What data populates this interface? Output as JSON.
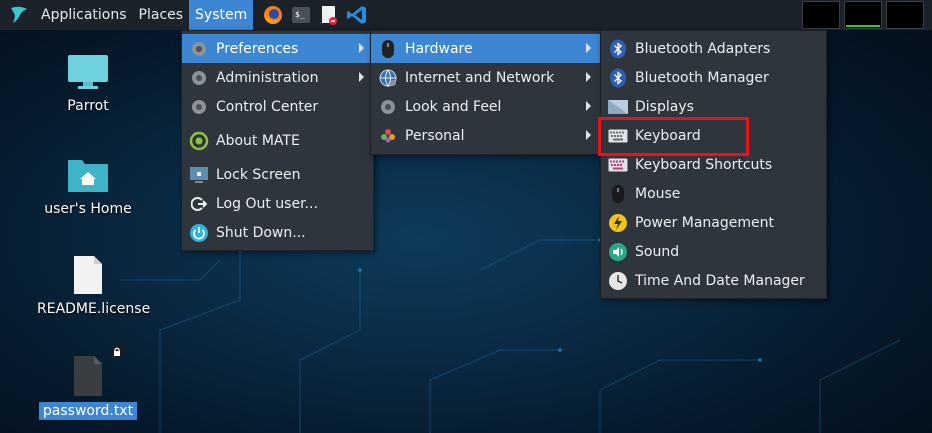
{
  "panel": {
    "menus": [
      "Applications",
      "Places",
      "System"
    ],
    "active_menu": "System",
    "launchers": [
      "firefox-icon",
      "terminal-icon",
      "text-editor-icon",
      "vscode-icon"
    ]
  },
  "desktop": {
    "icons": [
      {
        "label": "Parrot",
        "icon": "computer-icon"
      },
      {
        "label": "user's Home",
        "icon": "home-folder-icon"
      },
      {
        "label": "README.license",
        "icon": "document-icon"
      },
      {
        "label": "password.txt",
        "icon": "locked-file-icon",
        "selected": true
      }
    ]
  },
  "system_menu": {
    "items": [
      {
        "label": "Preferences",
        "icon": "gear-icon",
        "submenu": true,
        "highlighted": true
      },
      {
        "label": "Administration",
        "icon": "gear-icon",
        "submenu": true
      },
      {
        "label": "Control Center",
        "icon": "gear-icon"
      },
      {
        "label": "About MATE",
        "icon": "mate-logo-icon"
      },
      {
        "label": "Lock Screen",
        "icon": "lock-screen-icon"
      },
      {
        "label": "Log Out user...",
        "icon": "logout-icon"
      },
      {
        "label": "Shut Down...",
        "icon": "power-icon"
      }
    ]
  },
  "preferences_menu": {
    "items": [
      {
        "label": "Hardware",
        "icon": "mouse-icon",
        "submenu": true,
        "highlighted": true
      },
      {
        "label": "Internet and Network",
        "icon": "globe-icon",
        "submenu": true
      },
      {
        "label": "Look and Feel",
        "icon": "gear-icon",
        "submenu": true
      },
      {
        "label": "Personal",
        "icon": "flower-icon",
        "submenu": true
      }
    ]
  },
  "hardware_menu": {
    "items": [
      {
        "label": "Bluetooth Adapters",
        "icon": "bluetooth-icon"
      },
      {
        "label": "Bluetooth Manager",
        "icon": "bluetooth-icon"
      },
      {
        "label": "Displays",
        "icon": "display-icon"
      },
      {
        "label": "Keyboard",
        "icon": "keyboard-icon",
        "annotated": true
      },
      {
        "label": "Keyboard Shortcuts",
        "icon": "keyboard-shortcuts-icon"
      },
      {
        "label": "Mouse",
        "icon": "mouse-icon"
      },
      {
        "label": "Power Management",
        "icon": "power-management-icon"
      },
      {
        "label": "Sound",
        "icon": "sound-icon"
      },
      {
        "label": "Time And Date Manager",
        "icon": "clock-icon"
      }
    ]
  },
  "colors": {
    "highlight": "#3d86d4",
    "menu_bg": "#2f353d",
    "panel_bg": "#1b222a",
    "annotation": "#e8131a"
  }
}
